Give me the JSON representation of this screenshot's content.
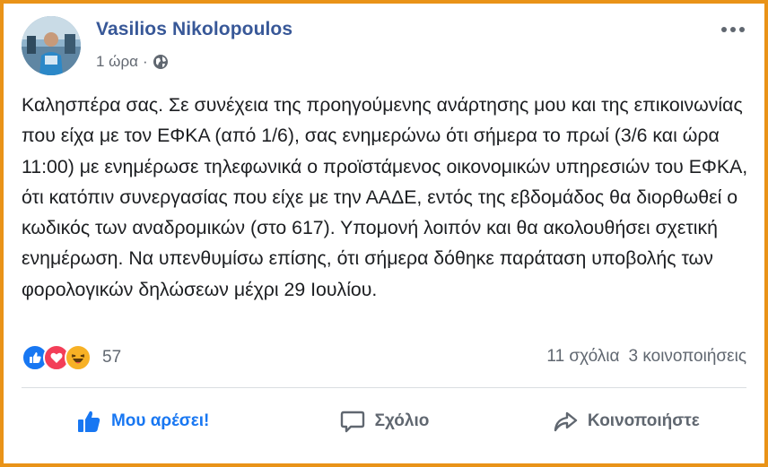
{
  "post": {
    "author": "Vasilios Nikolopoulos",
    "time": "1 ώρα",
    "separator": "·",
    "text": "Καλησπέρα σας. Σε συνέχεια της προηγούμενης ανάρτησης μου και της επικοινωνίας που είχα με τον ΕΦΚΑ (από 1/6), σας ενημερώνω ότι σήμερα το πρωί (3/6 και ώρα 11:00) με ενημέρωσε τηλεφωνικά ο προϊστάμενος οικονομικών υπηρεσιών του ΕΦΚΑ, ότι κατόπιν συνεργασίας που είχε με την ΑΑΔΕ, εντός της εβδομάδος θα διορθωθεί ο κωδικός των αναδρομικών (στο 617). Υπομονή λοιπόν και θα ακολουθήσει σχετική ενημέρωση. Να υπενθυμίσω επίσης, ότι σήμερα δόθηκε παράταση υποβολής των φορολογικών δηλώσεων μέχρι 29 Ιουλίου."
  },
  "reactions": {
    "icons": [
      "like-icon",
      "love-icon",
      "haha-icon"
    ],
    "count": "57"
  },
  "stats": {
    "comments": "11 σχόλια",
    "shares": "3 κοινοποιήσεις"
  },
  "actions": {
    "like": "Μου αρέσει!",
    "comment": "Σχόλιο",
    "share": "Κοινοποιήστε"
  },
  "colors": {
    "frame": "#e99318",
    "author": "#385898",
    "like_blue": "#1877f2",
    "love_red": "#f33e58",
    "haha_yellow": "#f7b125",
    "muted": "#606770"
  }
}
